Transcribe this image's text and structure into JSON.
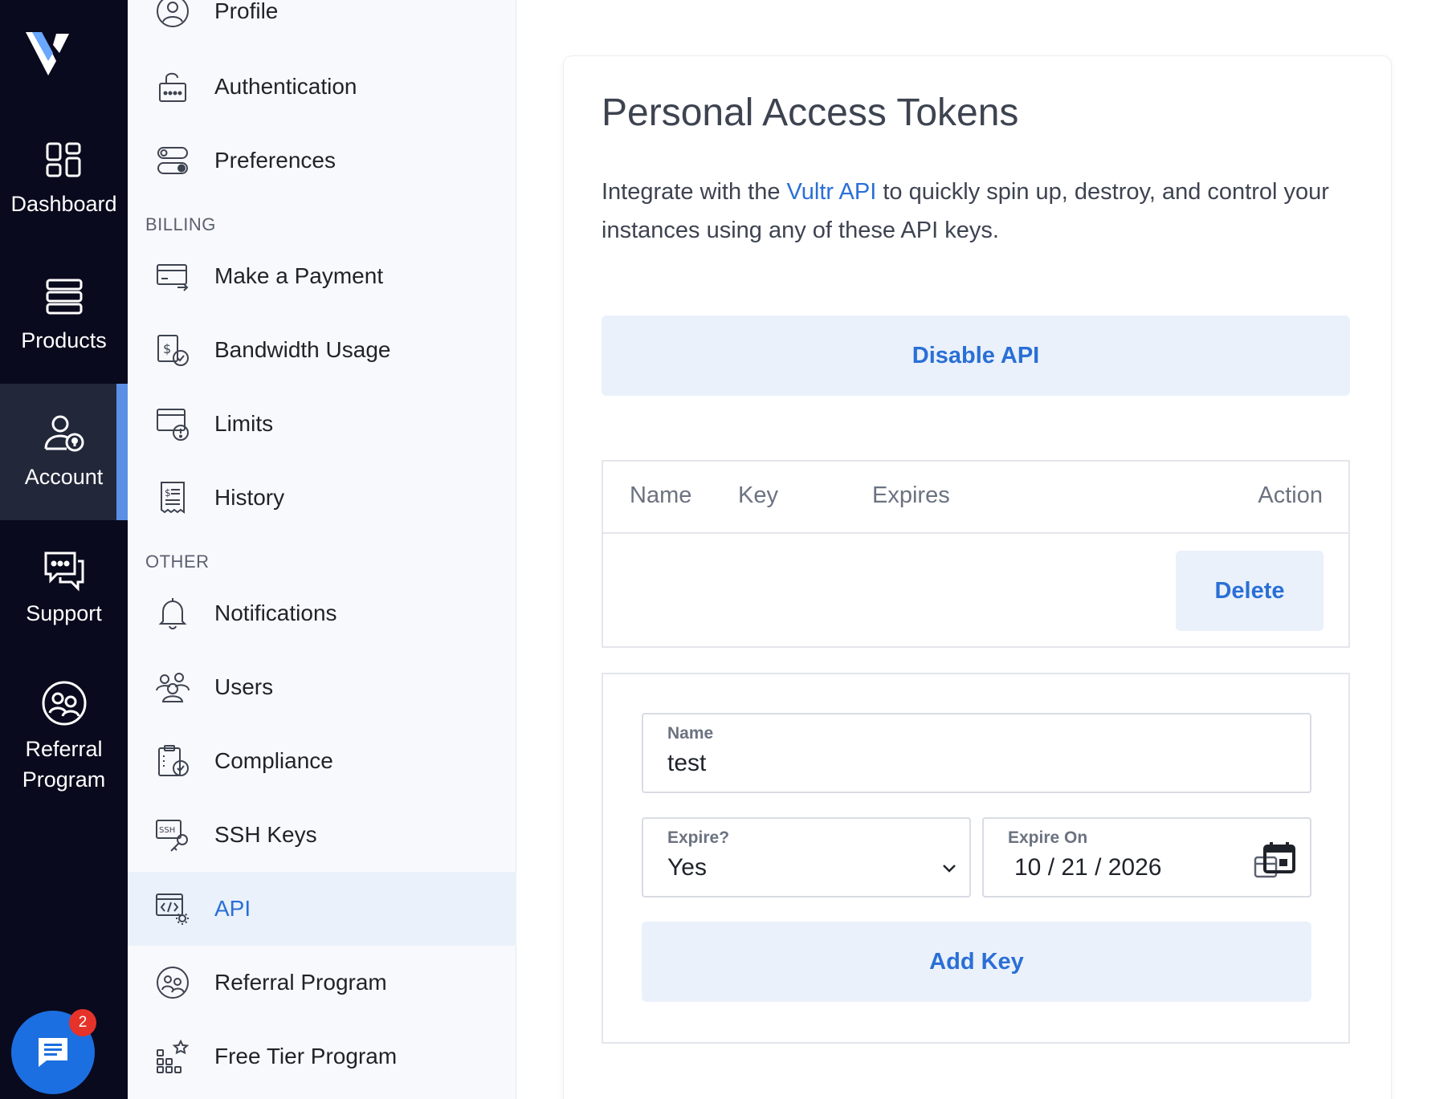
{
  "rail": {
    "items": [
      {
        "label": "Dashboard"
      },
      {
        "label": "Products"
      },
      {
        "label": "Account"
      },
      {
        "label": "Support"
      },
      {
        "label": "Referral Program"
      }
    ],
    "chat_badge": "2",
    "accent": "#5b8fe6"
  },
  "subnav": {
    "top_items": [
      {
        "label": "Profile",
        "icon": "user-circle-icon"
      },
      {
        "label": "Authentication",
        "icon": "lock-icon"
      },
      {
        "label": "Preferences",
        "icon": "toggle-icon"
      }
    ],
    "billing_label": "BILLING",
    "billing_items": [
      {
        "label": "Make a Payment",
        "icon": "credit-card-icon"
      },
      {
        "label": "Bandwidth Usage",
        "icon": "bandwidth-icon"
      },
      {
        "label": "Limits",
        "icon": "limits-icon"
      },
      {
        "label": "History",
        "icon": "receipt-icon"
      }
    ],
    "other_label": "OTHER",
    "other_items": [
      {
        "label": "Notifications",
        "icon": "bell-icon"
      },
      {
        "label": "Users",
        "icon": "users-icon"
      },
      {
        "label": "Compliance",
        "icon": "clipboard-check-icon"
      },
      {
        "label": "SSH Keys",
        "icon": "ssh-key-icon"
      },
      {
        "label": "API",
        "icon": "api-icon",
        "active": true
      },
      {
        "label": "Referral Program",
        "icon": "referral-icon"
      },
      {
        "label": "Free Tier Program",
        "icon": "free-tier-icon"
      }
    ]
  },
  "main": {
    "title": "Personal Access Tokens",
    "intro_before": "Integrate with the ",
    "intro_link": "Vultr API",
    "intro_after": " to quickly spin up, destroy, and control your instances using any of these API keys.",
    "disable_button": "Disable API",
    "table": {
      "columns": [
        "Name",
        "Key",
        "Expires",
        "Action"
      ],
      "delete_button": "Delete"
    },
    "form": {
      "name_label": "Name",
      "name_value": "test",
      "expire_label": "Expire?",
      "expire_value": "Yes",
      "expire_on_label": "Expire On",
      "expire_on_value": "10 / 21 / 2026",
      "add_button": "Add Key"
    }
  },
  "colors": {
    "rail_bg": "#0a0a1e",
    "link": "#2a6fd6",
    "soft_button_bg": "#eaf1fb",
    "chat": "#1c6fe0",
    "badge": "#e5332a"
  }
}
